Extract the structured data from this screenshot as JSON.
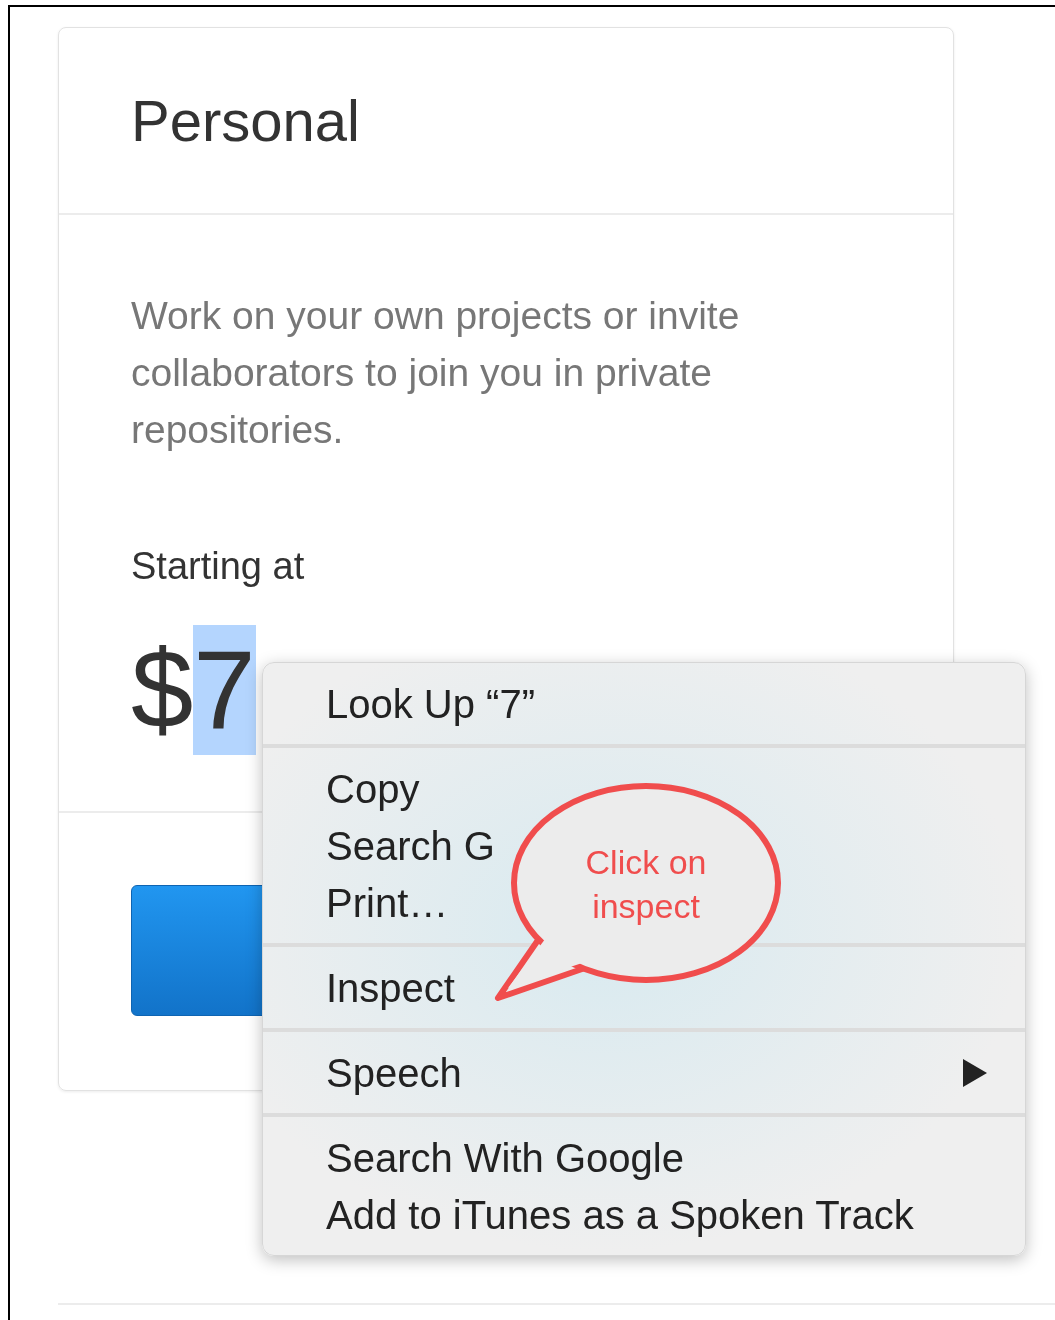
{
  "card": {
    "title": "Personal",
    "description": "Work on your own projects or invite collaborators to join you in private repositories.",
    "price_label": "Starting at",
    "price": {
      "currency": "$",
      "amount": "7",
      "selected": true
    }
  },
  "context_menu": {
    "groups": [
      [
        {
          "label": "Look Up “7”"
        }
      ],
      [
        {
          "label": "Copy"
        },
        {
          "label": "Search G"
        },
        {
          "label": "Print…"
        }
      ],
      [
        {
          "label": "Inspect"
        }
      ],
      [
        {
          "label": "Speech",
          "has_submenu": true
        }
      ],
      [
        {
          "label": "Search With Google"
        },
        {
          "label": "Add to iTunes as a Spoken Track"
        }
      ]
    ]
  },
  "callout": {
    "text": "Click on inspect"
  }
}
